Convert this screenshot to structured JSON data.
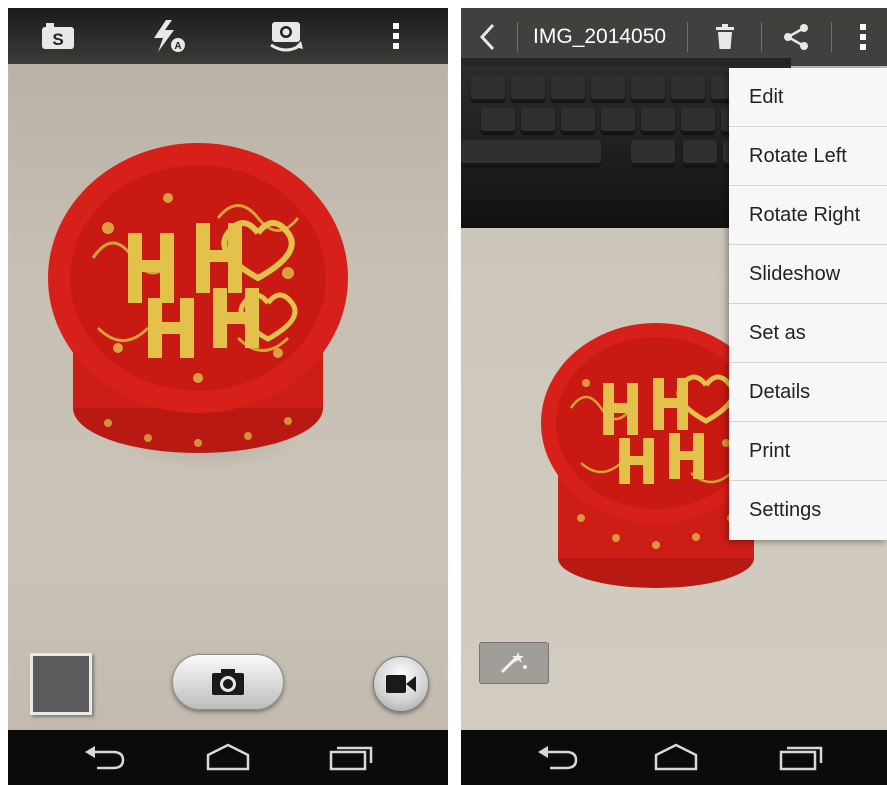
{
  "camera": {
    "top_icons": [
      "scene-s-camera-icon",
      "flash-auto-icon",
      "switch-camera-icon",
      "overflow-menu-icon"
    ],
    "bottom": {
      "thumbnail": "last-photo-thumbnail",
      "shutter": "camera-shutter-icon",
      "video": "video-camera-icon"
    },
    "nav": [
      "back-icon",
      "home-icon",
      "recents-icon"
    ]
  },
  "gallery": {
    "title": "IMG_2014050",
    "actions": [
      "back-chevron-icon",
      "trash-icon",
      "share-icon",
      "overflow-menu-icon"
    ],
    "menu_items": [
      {
        "label": "Edit"
      },
      {
        "label": "Rotate Left"
      },
      {
        "label": "Rotate Right"
      },
      {
        "label": "Slideshow"
      },
      {
        "label": "Set as"
      },
      {
        "label": "Details"
      },
      {
        "label": "Print"
      },
      {
        "label": "Settings"
      }
    ],
    "magic_button": "magic-wand-icon",
    "nav": [
      "back-icon",
      "home-icon",
      "recents-icon"
    ]
  },
  "colors": {
    "tin_red": "#d8201a",
    "gold": "#d7b437",
    "bar_dark": "#0b0b0b",
    "menu_bg": "#f7f7f7"
  }
}
